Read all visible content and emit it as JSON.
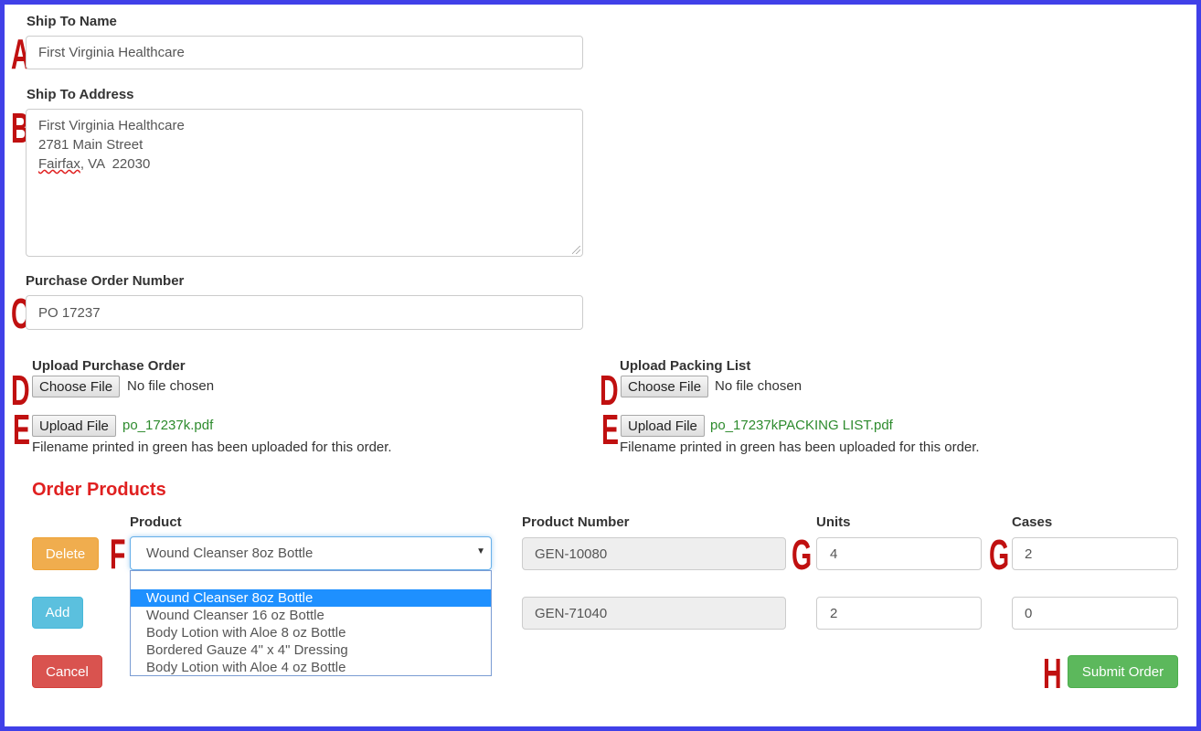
{
  "ship_to_name": {
    "label": "Ship To Name",
    "value": "First Virginia Healthcare",
    "marker": "A"
  },
  "ship_to_address": {
    "label": "Ship To Address",
    "lines": [
      "First Virginia Healthcare",
      "2781 Main Street"
    ],
    "city": "Fairfax",
    "city_rest": ", VA  22030",
    "marker": "B"
  },
  "purchase_order": {
    "label": "Purchase Order Number",
    "value": "PO 17237",
    "marker": "C"
  },
  "upload_po": {
    "label": "Upload Purchase Order",
    "choose_label": "Choose File",
    "no_file": "No file chosen",
    "upload_label": "Upload File",
    "uploaded_file": "po_17237k.pdf",
    "note": "Filename printed in green has been uploaded for this order.",
    "marker_choose": "D",
    "marker_upload": "E"
  },
  "upload_packing": {
    "label": "Upload Packing List",
    "choose_label": "Choose File",
    "no_file": "No file chosen",
    "upload_label": "Upload File",
    "uploaded_file": "po_17237kPACKING LIST.pdf",
    "note": "Filename printed in green has been uploaded for this order.",
    "marker_choose": "D",
    "marker_upload": "E"
  },
  "order_products": {
    "title": "Order Products",
    "headers": {
      "product": "Product",
      "product_number": "Product Number",
      "units": "Units",
      "cases": "Cases"
    },
    "rows": [
      {
        "product": "Wound Cleanser 8oz Bottle",
        "product_number": "GEN-10080",
        "units": "4",
        "cases": "2"
      },
      {
        "product": "",
        "product_number": "GEN-71040",
        "units": "2",
        "cases": "0"
      }
    ],
    "dropdown_options": [
      "",
      "Wound Cleanser 8oz Bottle",
      "Wound Cleanser 16 oz Bottle",
      "Body Lotion with Aloe 8 oz Bottle",
      "Bordered Gauze 4\" x 4\" Dressing",
      "Body Lotion with Aloe 4 oz Bottle"
    ],
    "selected_option_index": 1,
    "marker_product": "F",
    "marker_units": "G",
    "marker_cases": "G"
  },
  "buttons": {
    "delete": "Delete",
    "add": "Add",
    "cancel": "Cancel",
    "submit": "Submit Order",
    "marker_submit": "H"
  },
  "colors": {
    "frame": "#4040e8",
    "marker": "#c01010",
    "section_title": "#e02020",
    "uploaded": "#2e8b2e",
    "delete": "#f0ad4e",
    "add": "#5bc0de",
    "cancel": "#d9534f",
    "submit": "#5cb85c",
    "dropdown_highlight": "#1e90ff"
  }
}
